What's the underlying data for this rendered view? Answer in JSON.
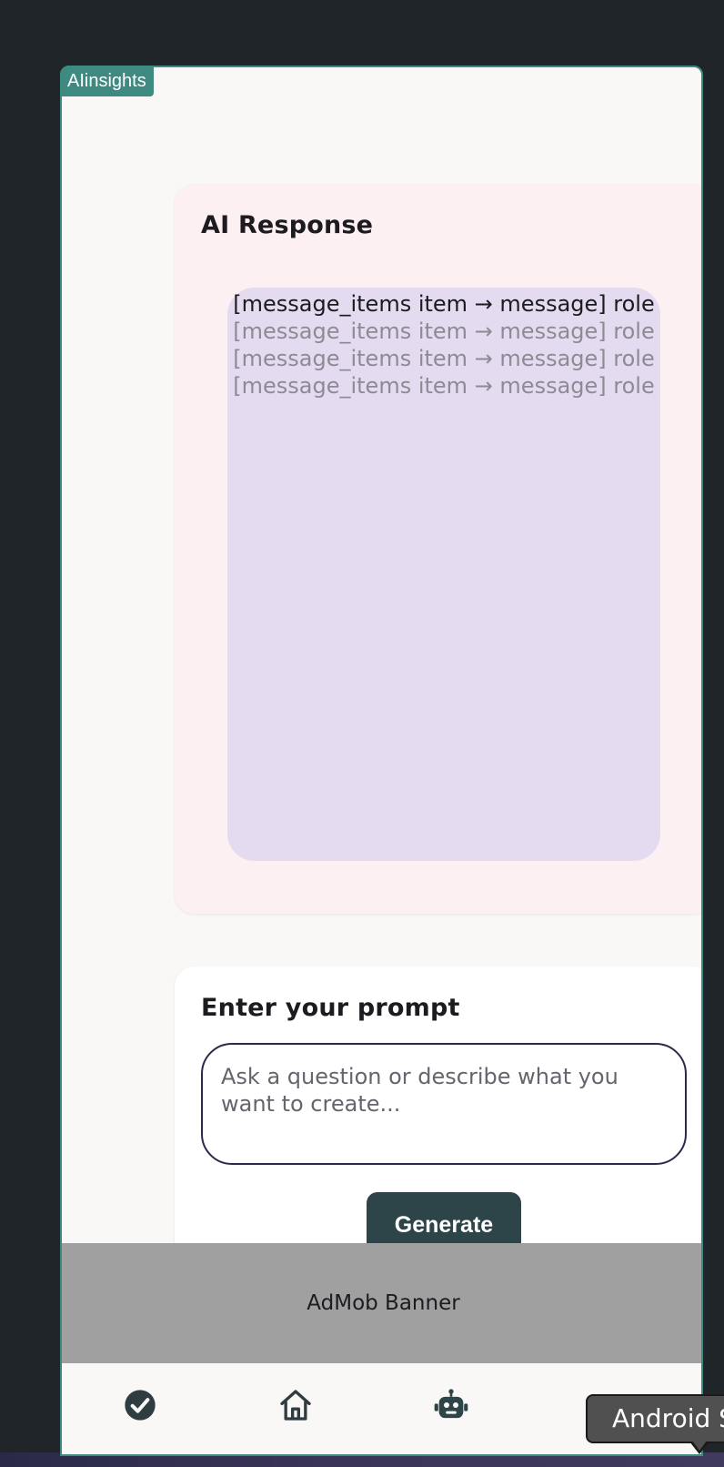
{
  "frame": {
    "tag": "AIinsights"
  },
  "ai_card": {
    "title": "AI Response",
    "messages": [
      {
        "text": "[message_items item → message] role",
        "state": "active"
      },
      {
        "text": "[message_items item → message] role",
        "state": "faded"
      },
      {
        "text": "[message_items item → message] role",
        "state": "faded"
      },
      {
        "text": "[message_items item → message] role",
        "state": "faded"
      }
    ]
  },
  "prompt_card": {
    "title": "Enter your prompt",
    "input_value": "",
    "placeholder": "Ask a question or describe what you want to create...",
    "generate_label": "Generate"
  },
  "ad": {
    "label": "AdMob Banner"
  },
  "nav": {
    "items": [
      {
        "icon": "check-circle-icon"
      },
      {
        "icon": "home-icon"
      },
      {
        "icon": "robot-icon"
      }
    ]
  },
  "tooltip": {
    "text": "Android S"
  },
  "colors": {
    "background": "#1f2528",
    "frame_border": "#3e8a80",
    "ai_card_bg": "#fcf0f3",
    "messages_bg": "#e5dbf0",
    "button_bg": "#2d4448",
    "admob_bg": "#a0a0a0"
  }
}
